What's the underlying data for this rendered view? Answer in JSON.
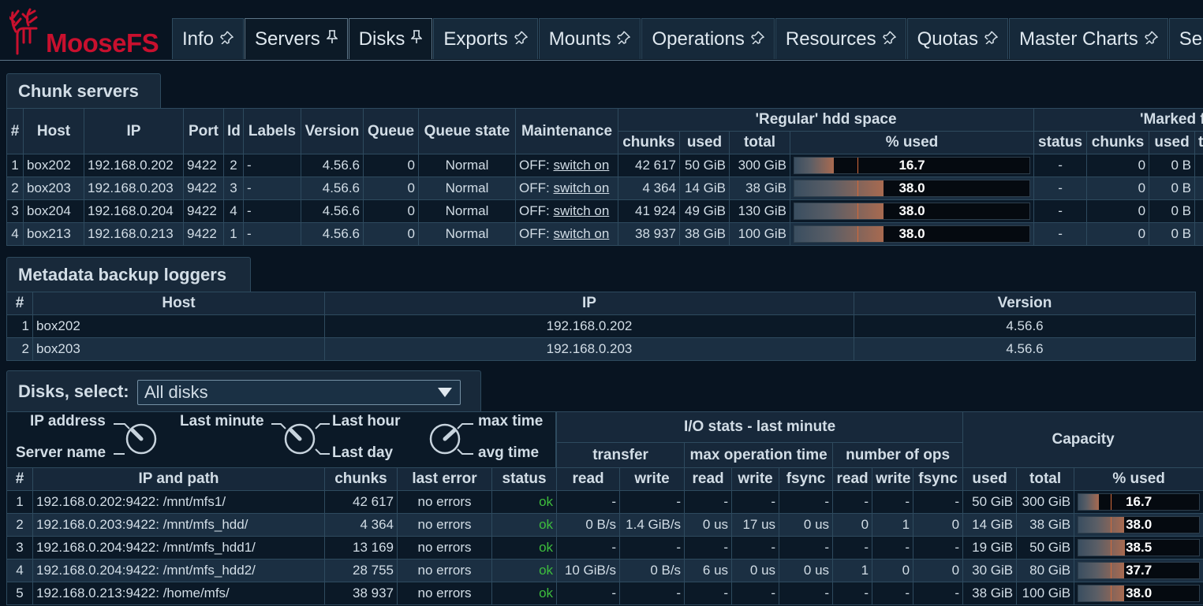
{
  "app": {
    "logo_text": "MooseFS",
    "brand_color": "#c8102e"
  },
  "tabs": [
    {
      "label": "Info",
      "icon": "pin-icon",
      "active": false
    },
    {
      "label": "Servers",
      "icon": "pin-icon",
      "active": true
    },
    {
      "label": "Disks",
      "icon": "pin-icon",
      "active": true
    },
    {
      "label": "Exports",
      "icon": "pin-icon",
      "active": false
    },
    {
      "label": "Mounts",
      "icon": "pin-icon",
      "active": false
    },
    {
      "label": "Operations",
      "icon": "pin-icon",
      "active": false
    },
    {
      "label": "Resources",
      "icon": "pin-icon",
      "active": false
    },
    {
      "label": "Quotas",
      "icon": "pin-icon",
      "active": false
    },
    {
      "label": "Master Charts",
      "icon": "pin-icon",
      "active": false
    },
    {
      "label": "Se",
      "icon": "",
      "active": false
    }
  ],
  "chunk_servers": {
    "title": "Chunk servers",
    "headers": {
      "num": "#",
      "host": "Host",
      "ip": "IP",
      "port": "Port",
      "id": "Id",
      "labels": "Labels",
      "version": "Version",
      "queue": "Queue",
      "queue_state": "Queue state",
      "maintenance": "Maintenance",
      "regular_group": "'Regular' hdd space",
      "marked_group": "'Marked f",
      "chunks": "chunks",
      "used": "used",
      "total": "total",
      "pct_used": "% used",
      "status": "status",
      "m_chunks": "chunks",
      "m_used": "used",
      "m_total": "to"
    },
    "rows": [
      {
        "num": "1",
        "host": "box202",
        "ip": "192.168.0.202",
        "port": "9422",
        "id": "2",
        "labels": "-",
        "version": "4.56.6",
        "queue": "0",
        "queue_state": "Normal",
        "maint_prefix": "OFF:",
        "maint_link": "switch on",
        "chunks": "42 617",
        "used": "50 GiB",
        "total": "300 GiB",
        "pct": "16.7",
        "pct_value": 16.7,
        "m_status": "-",
        "m_chunks": "0",
        "m_used": "0 B"
      },
      {
        "num": "2",
        "host": "box203",
        "ip": "192.168.0.203",
        "port": "9422",
        "id": "3",
        "labels": "-",
        "version": "4.56.6",
        "queue": "0",
        "queue_state": "Normal",
        "maint_prefix": "OFF:",
        "maint_link": "switch on",
        "chunks": "4 364",
        "used": "14 GiB",
        "total": "38 GiB",
        "pct": "38.0",
        "pct_value": 38.0,
        "m_status": "-",
        "m_chunks": "0",
        "m_used": "0 B"
      },
      {
        "num": "3",
        "host": "box204",
        "ip": "192.168.0.204",
        "port": "9422",
        "id": "4",
        "labels": "-",
        "version": "4.56.6",
        "queue": "0",
        "queue_state": "Normal",
        "maint_prefix": "OFF:",
        "maint_link": "switch on",
        "chunks": "41 924",
        "used": "49 GiB",
        "total": "130 GiB",
        "pct": "38.0",
        "pct_value": 38.0,
        "m_status": "-",
        "m_chunks": "0",
        "m_used": "0 B"
      },
      {
        "num": "4",
        "host": "box213",
        "ip": "192.168.0.213",
        "port": "9422",
        "id": "1",
        "labels": "-",
        "version": "4.56.6",
        "queue": "0",
        "queue_state": "Normal",
        "maint_prefix": "OFF:",
        "maint_link": "switch on",
        "chunks": "38 937",
        "used": "38 GiB",
        "total": "100 GiB",
        "pct": "38.0",
        "pct_value": 38.0,
        "m_status": "-",
        "m_chunks": "0",
        "m_used": "0 B"
      }
    ]
  },
  "metaloggers": {
    "title": "Metadata backup loggers",
    "headers": {
      "num": "#",
      "host": "Host",
      "ip": "IP",
      "version": "Version"
    },
    "rows": [
      {
        "num": "1",
        "host": "box202",
        "ip": "192.168.0.202",
        "version": "4.56.6"
      },
      {
        "num": "2",
        "host": "box203",
        "ip": "192.168.0.203",
        "version": "4.56.6"
      }
    ]
  },
  "disks": {
    "title": "Disks, select:",
    "select_value": "All disks",
    "knobs": {
      "ip_address": "IP address",
      "server_name": "Server name",
      "last_minute": "Last minute",
      "last_hour": "Last hour",
      "last_day": "Last day",
      "max_time": "max time",
      "avg_time": "avg time"
    },
    "headers": {
      "io_group": "I/O stats - last minute",
      "capacity_group": "Capacity",
      "transfer": "transfer",
      "max_op_time": "max operation time",
      "num_ops": "number of ops",
      "num": "#",
      "ip_path": "IP and path",
      "chunks": "chunks",
      "last_error": "last error",
      "status": "status",
      "t_read": "read",
      "t_write": "write",
      "o_read": "read",
      "o_write": "write",
      "o_fsync": "fsync",
      "n_read": "read",
      "n_write": "write",
      "n_fsync": "fsync",
      "used": "used",
      "total": "total",
      "pct_used": "% used"
    },
    "rows": [
      {
        "num": "1",
        "path": "192.168.0.202:9422: /mnt/mfs1/",
        "chunks": "42 617",
        "last_error": "no errors",
        "status": "ok",
        "t_read": "-",
        "t_write": "-",
        "o_read": "-",
        "o_write": "-",
        "o_fsync": "-",
        "n_read": "-",
        "n_write": "-",
        "n_fsync": "-",
        "used": "50 GiB",
        "total": "300 GiB",
        "pct": "16.7",
        "pct_value": 16.7
      },
      {
        "num": "2",
        "path": "192.168.0.203:9422: /mnt/mfs_hdd/",
        "chunks": "4 364",
        "last_error": "no errors",
        "status": "ok",
        "t_read": "0 B/s",
        "t_write": "1.4 GiB/s",
        "o_read": "0 us",
        "o_write": "17 us",
        "o_fsync": "0 us",
        "n_read": "0",
        "n_write": "1",
        "n_fsync": "0",
        "used": "14 GiB",
        "total": "38 GiB",
        "pct": "38.0",
        "pct_value": 38.0
      },
      {
        "num": "3",
        "path": "192.168.0.204:9422: /mnt/mfs_hdd1/",
        "chunks": "13 169",
        "last_error": "no errors",
        "status": "ok",
        "t_read": "-",
        "t_write": "-",
        "o_read": "-",
        "o_write": "-",
        "o_fsync": "-",
        "n_read": "-",
        "n_write": "-",
        "n_fsync": "-",
        "used": "19 GiB",
        "total": "50 GiB",
        "pct": "38.5",
        "pct_value": 38.5
      },
      {
        "num": "4",
        "path": "192.168.0.204:9422: /mnt/mfs_hdd2/",
        "chunks": "28 755",
        "last_error": "no errors",
        "status": "ok",
        "t_read": "10 GiB/s",
        "t_write": "0 B/s",
        "o_read": "6 us",
        "o_write": "0 us",
        "o_fsync": "0 us",
        "n_read": "1",
        "n_write": "0",
        "n_fsync": "0",
        "used": "30 GiB",
        "total": "80 GiB",
        "pct": "37.7",
        "pct_value": 37.7
      },
      {
        "num": "5",
        "path": "192.168.0.213:9422: /home/mfs/",
        "chunks": "38 937",
        "last_error": "no errors",
        "status": "ok",
        "t_read": "-",
        "t_write": "-",
        "o_read": "-",
        "o_write": "-",
        "o_fsync": "-",
        "n_read": "-",
        "n_write": "-",
        "n_fsync": "-",
        "used": "38 GiB",
        "total": "100 GiB",
        "pct": "38.0",
        "pct_value": 38.0
      }
    ]
  },
  "colors": {
    "ok": "#3dbd3d",
    "bar_mark": "#d26a3a",
    "background": "#081421"
  }
}
